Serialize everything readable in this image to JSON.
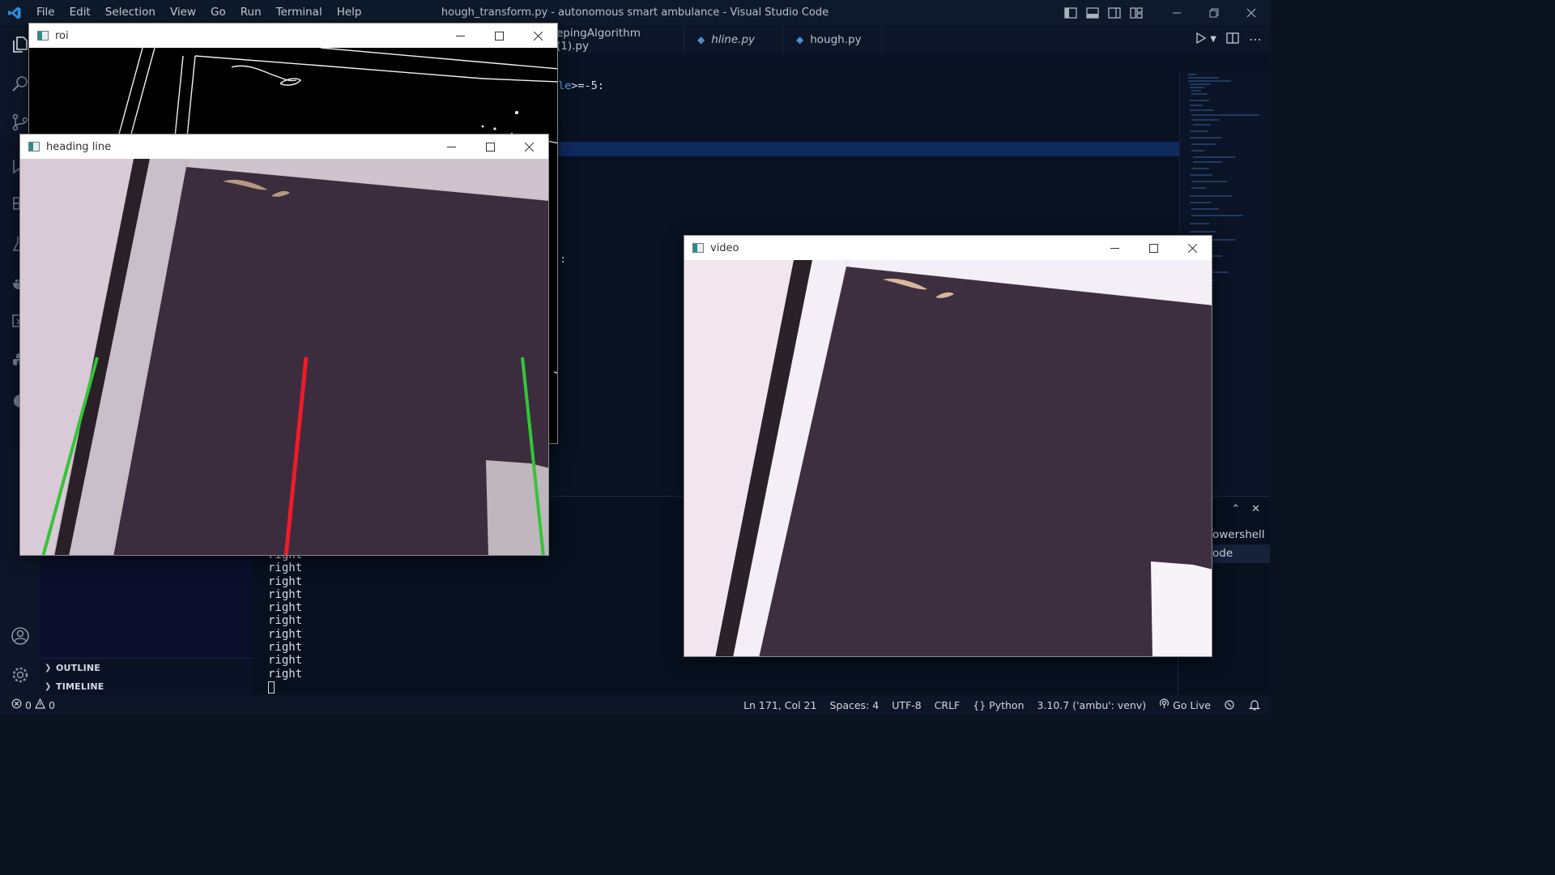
{
  "titlebar": {
    "menu": [
      "File",
      "Edit",
      "Selection",
      "View",
      "Go",
      "Run",
      "Terminal",
      "Help"
    ],
    "title": "hough_transform.py - autonomous smart ambulance - Visual Studio Code"
  },
  "editor": {
    "tabs": [
      {
        "label": "epingAlgorithm (1).py"
      },
      {
        "label": "hline.py"
      },
      {
        "label": "hough.py"
      }
    ],
    "code_fragments": {
      "line1_ident": "le",
      "line1_op": ">=-",
      "line1_num": "5",
      "line1_colon": ":",
      "line2_paren": ")",
      "line2_colon": ":"
    }
  },
  "sidebar": {
    "outline_label": "OUTLINE",
    "timeline_label": "TIMELINE"
  },
  "terminal": {
    "lines": [
      "right",
      "right",
      "right",
      "right",
      "right",
      "right",
      "right",
      "right",
      "right",
      "right"
    ],
    "list": [
      "owershell",
      "ode"
    ]
  },
  "statusbar": {
    "errors": "0",
    "warnings": "0",
    "position": "Ln 171, Col 21",
    "spaces": "Spaces: 4",
    "encoding": "UTF-8",
    "eol": "CRLF",
    "language": "Python",
    "interpreter": "3.10.7 ('ambu': venv)",
    "golive": "Go Live"
  },
  "cv_windows": {
    "roi": {
      "title": "roi"
    },
    "heading": {
      "title": "heading line"
    },
    "video": {
      "title": "video"
    }
  },
  "colors": {
    "accent": "#0e1a2b",
    "lane_green": "#35c437",
    "heading_red": "#f01a2a"
  }
}
